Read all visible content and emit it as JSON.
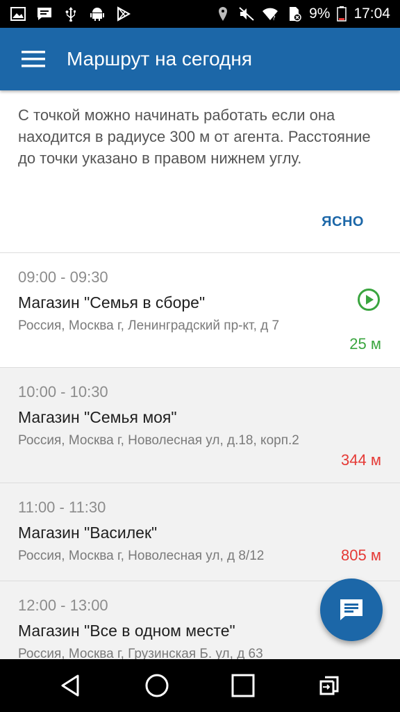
{
  "status_bar": {
    "battery_percent": "9%",
    "time": "17:04",
    "left_icons": [
      "image-icon",
      "message-icon",
      "usb-icon",
      "android-icon",
      "play-store-icon"
    ],
    "right_icons": [
      "location-icon",
      "mute-icon",
      "wifi-icon",
      "sim-icon",
      "battery-icon"
    ]
  },
  "app_bar": {
    "title": "Маршрут на сегодня",
    "background": "#1c67a8"
  },
  "info": {
    "text": "С точкой можно начинать работать если она находится в радиусе 300 м от агента. Расстояние до точки указано в правом нижнем углу.",
    "ok_label": "ЯСНО"
  },
  "routes": [
    {
      "time": "09:00 - 09:30",
      "name": "Магазин \"Семья в сборе\"",
      "address": "Россия, Москва г, Ленинградский пр-кт, д 7",
      "distance": "25 м",
      "status": "near"
    },
    {
      "time": "10:00 - 10:30",
      "name": "Магазин \"Семья моя\"",
      "address": "Россия, Москва г, Новолесная ул, д.18, корп.2",
      "distance": "344 м",
      "status": "far"
    },
    {
      "time": "11:00 - 11:30",
      "name": "Магазин \"Василек\"",
      "address": "Россия, Москва г, Новолесная ул, д 8/12",
      "distance": "805 м",
      "status": "far"
    },
    {
      "time": "12:00 - 13:00",
      "name": "Магазин \"Все в одном месте\"",
      "address": "Россия, Москва г, Грузинская Б. ул, д 63",
      "distance": "",
      "status": "far"
    }
  ],
  "colors": {
    "accent": "#1c67a8",
    "near": "#3aa53f",
    "far": "#e53935"
  },
  "fab": {
    "icon": "chat-icon"
  },
  "nav_bar": {
    "icons": [
      "back-icon",
      "home-icon",
      "recents-icon",
      "switch-icon"
    ]
  }
}
